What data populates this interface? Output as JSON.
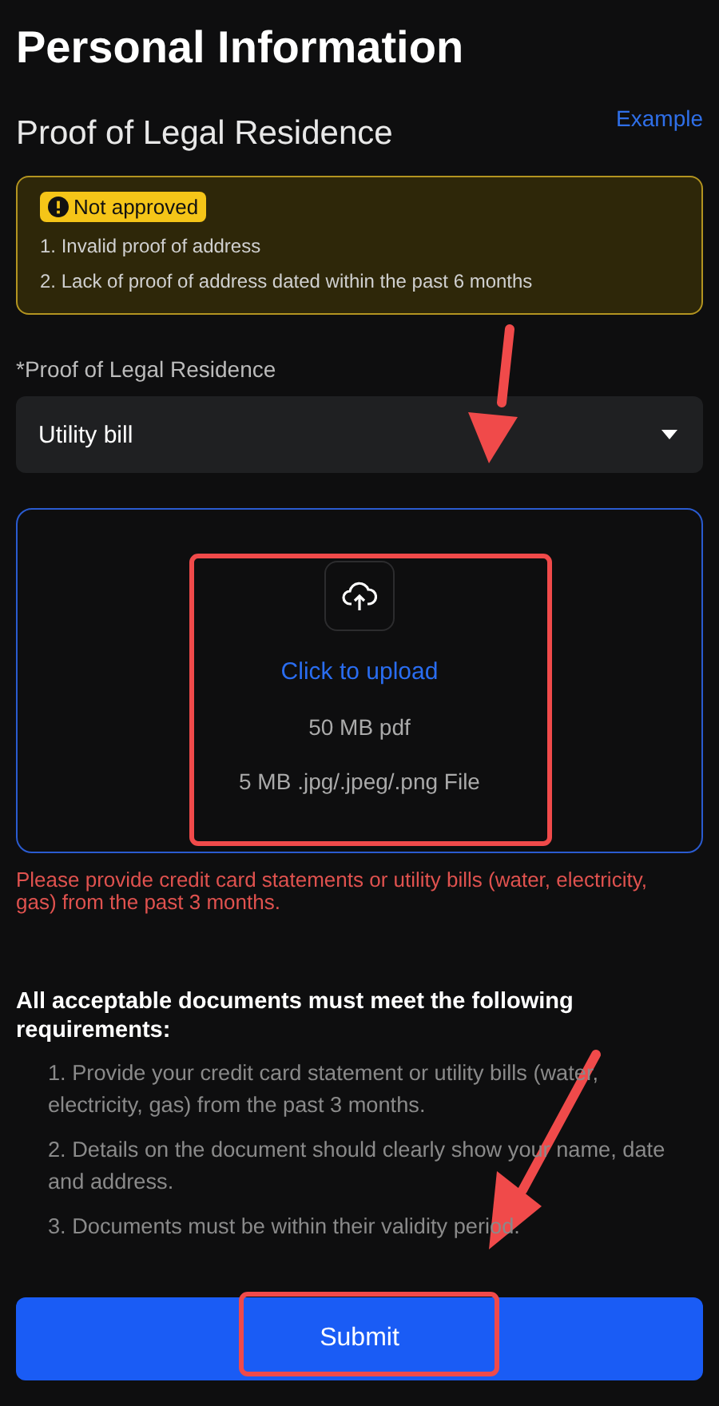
{
  "title": "Personal Information",
  "section": {
    "title": "Proof of Legal Residence",
    "link": "Example"
  },
  "notice": {
    "badge": "Not approved",
    "reasons": [
      "1. Invalid proof of address",
      "2. Lack of proof of address dated within the past 6 months"
    ]
  },
  "field": {
    "label": "*Proof of Legal Residence",
    "value": "Utility bill"
  },
  "upload": {
    "action": "Click to upload",
    "limits": [
      "50 MB pdf",
      "5 MB .jpg/.jpeg/.png File"
    ]
  },
  "error": "Please provide credit card statements or utility bills (water, electricity, gas) from the past 3 months.",
  "requirements": {
    "heading": "All acceptable documents must meet the following requirements:",
    "items": [
      "1. Provide your credit card statement or utility bills (water, electricity, gas) from the past 3 months.",
      "2. Details on the document should clearly show your name, date and address.",
      "3. Documents must be within their validity period."
    ]
  },
  "submit": "Submit"
}
